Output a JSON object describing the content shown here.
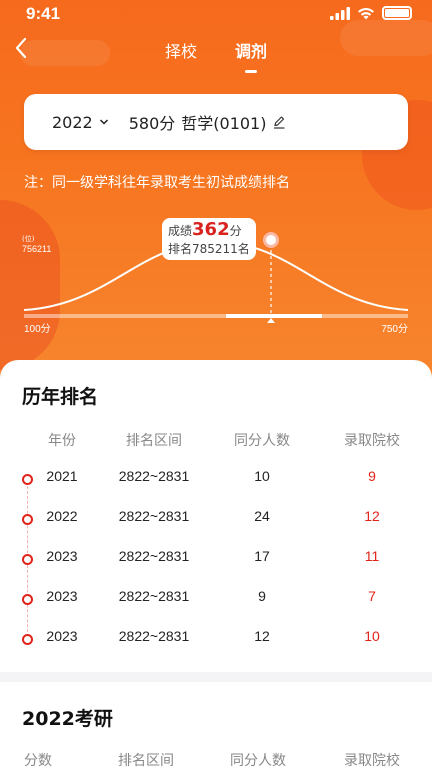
{
  "status": {
    "time": "9:41"
  },
  "nav": {
    "tabs": [
      {
        "label": "择校"
      },
      {
        "label": "调剂"
      }
    ]
  },
  "selector": {
    "year": "2022",
    "score": "580分",
    "subject": "哲学(0101)"
  },
  "note": "注：同一级学科往年录取考生初试成绩排名",
  "distribution": {
    "y_unit": "(位)",
    "y_value": "756211",
    "x_min_label": "100分",
    "x_max_label": "750分",
    "x_min": 100,
    "x_max": 750,
    "marker_score": 362,
    "tooltip": {
      "score_prefix": "成绩",
      "score": "362",
      "score_suffix": "分",
      "rank_text": "排名785211名"
    }
  },
  "history": {
    "title": "历年排名",
    "headers": {
      "year": "年份",
      "range": "排名区间",
      "count": "同分人数",
      "schools": "录取院校"
    },
    "rows": [
      {
        "year": "2021",
        "range": "2822~2831",
        "count": "10",
        "schools": "9"
      },
      {
        "year": "2022",
        "range": "2822~2831",
        "count": "24",
        "schools": "12"
      },
      {
        "year": "2023",
        "range": "2822~2831",
        "count": "17",
        "schools": "11"
      },
      {
        "year": "2023",
        "range": "2822~2831",
        "count": "9",
        "schools": "7"
      },
      {
        "year": "2023",
        "range": "2822~2831",
        "count": "12",
        "schools": "10"
      }
    ]
  },
  "exam": {
    "title": "2022考研",
    "headers": {
      "score": "分数",
      "range": "排名区间",
      "count": "同分人数",
      "schools": "录取院校"
    }
  },
  "colors": {
    "accent": "#f66a1e",
    "red": "#e2231a"
  }
}
